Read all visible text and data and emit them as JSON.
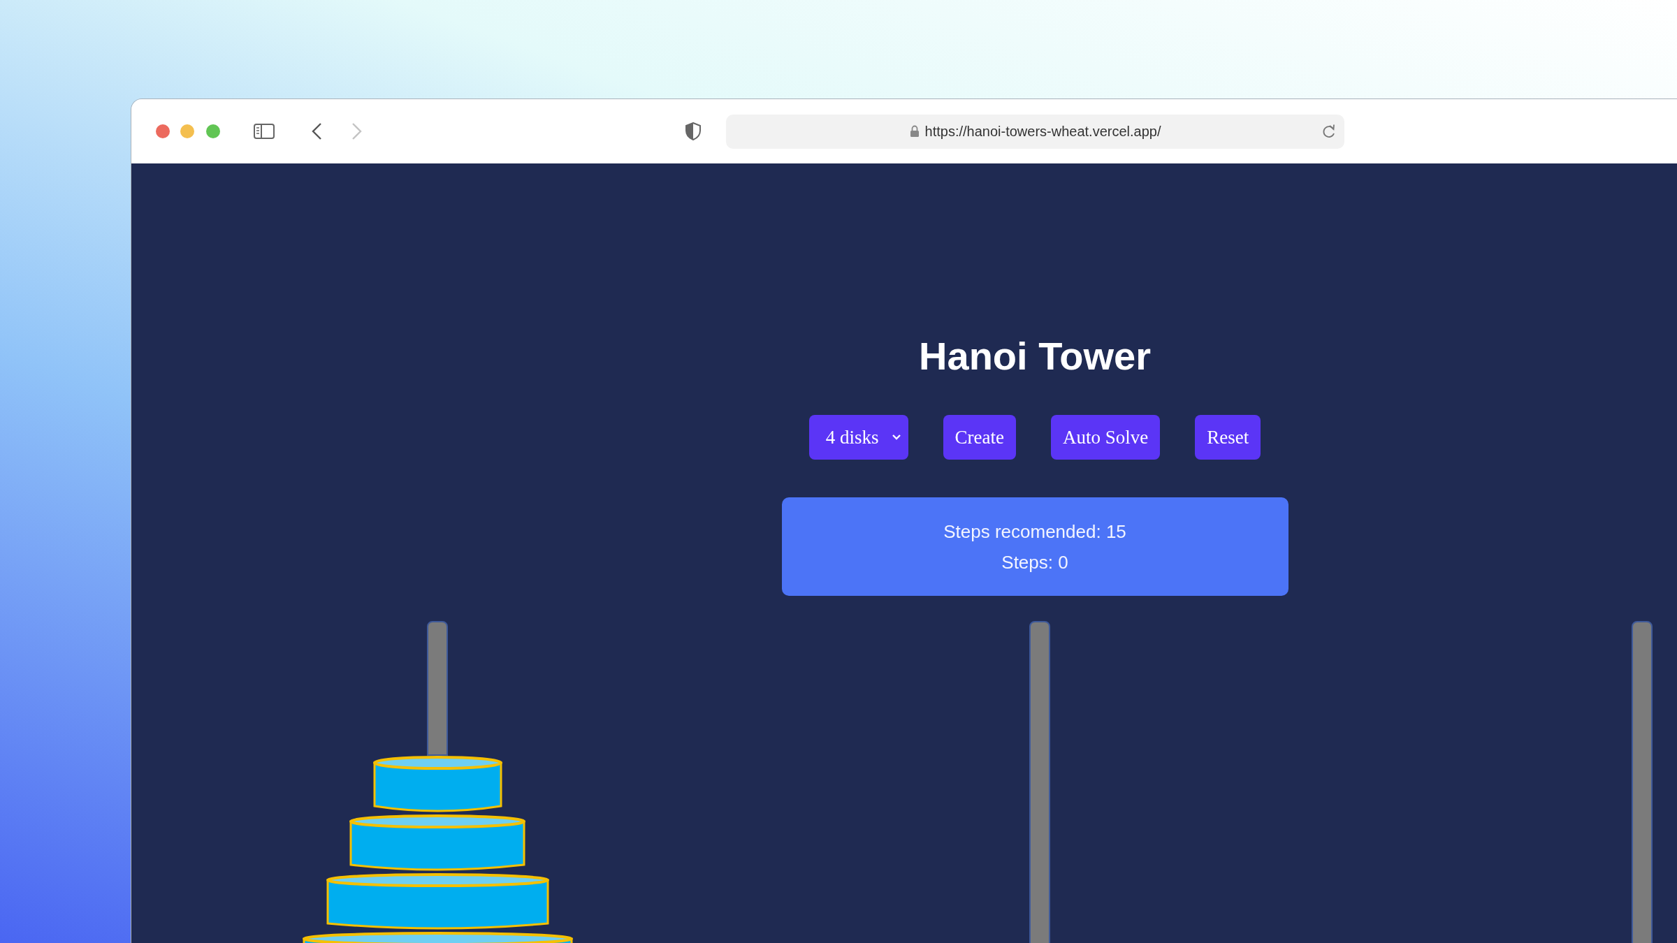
{
  "browser": {
    "url": "https://hanoi-towers-wheat.vercel.app/",
    "back_disabled": false,
    "forward_disabled": true
  },
  "title": "Hanoi Tower",
  "controls": {
    "disk_select": "4 disks",
    "buttons": [
      "Create",
      "Auto Solve",
      "Reset"
    ]
  },
  "info": {
    "steps_recommended": "Steps recomended: 15",
    "steps": "Steps: 0"
  }
}
